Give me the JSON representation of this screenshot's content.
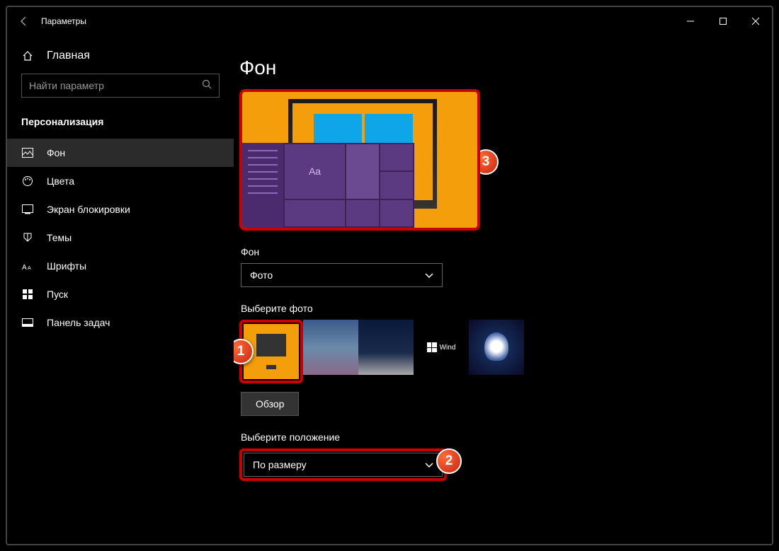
{
  "titlebar": {
    "title": "Параметры"
  },
  "sidebar": {
    "home_label": "Главная",
    "search_placeholder": "Найти параметр",
    "section_label": "Персонализация",
    "items": [
      {
        "label": "Фон"
      },
      {
        "label": "Цвета"
      },
      {
        "label": "Экран блокировки"
      },
      {
        "label": "Темы"
      },
      {
        "label": "Шрифты"
      },
      {
        "label": "Пуск"
      },
      {
        "label": "Панель задач"
      }
    ]
  },
  "main": {
    "page_title": "Фон",
    "preview_aa": "Aa",
    "bg_label": "Фон",
    "bg_value": "Фото",
    "choose_photo_label": "Выберите фото",
    "browse_label": "Обзор",
    "thumb4_text": "Wind",
    "position_label": "Выберите положение",
    "position_value": "По размеру"
  },
  "badges": {
    "b1": "1",
    "b2": "2",
    "b3": "3"
  }
}
